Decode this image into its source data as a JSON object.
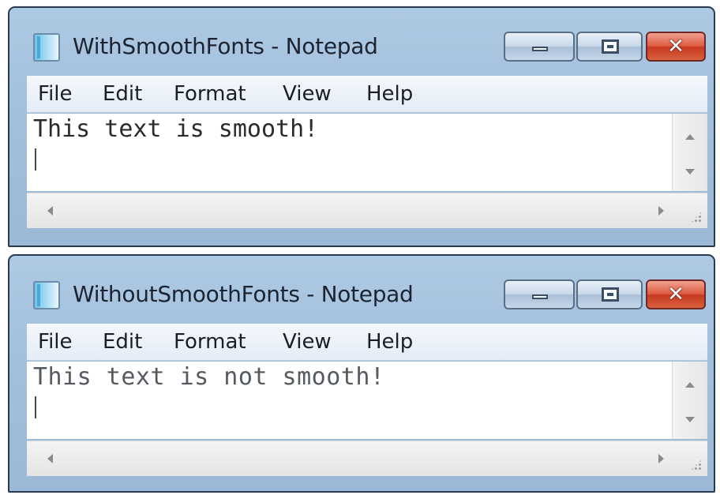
{
  "windows": [
    {
      "title": "WithSmoothFonts - Notepad",
      "menu": [
        "File",
        "Edit",
        "Format",
        "View",
        "Help"
      ],
      "content": "This text is smooth!"
    },
    {
      "title": "WithoutSmoothFonts - Notepad",
      "menu": [
        "File",
        "Edit",
        "Format",
        "View",
        "Help"
      ],
      "content": "This text is not smooth!"
    }
  ],
  "colors": {
    "titlebar": "#a9c5e1",
    "close_button": "#d5472a",
    "editor_background": "#ffffff"
  },
  "icons": [
    "notepad-icon",
    "minimize-icon",
    "maximize-icon",
    "close-icon",
    "scroll-up-icon",
    "scroll-down-icon",
    "scroll-left-icon",
    "scroll-right-icon",
    "size-grip-icon"
  ]
}
